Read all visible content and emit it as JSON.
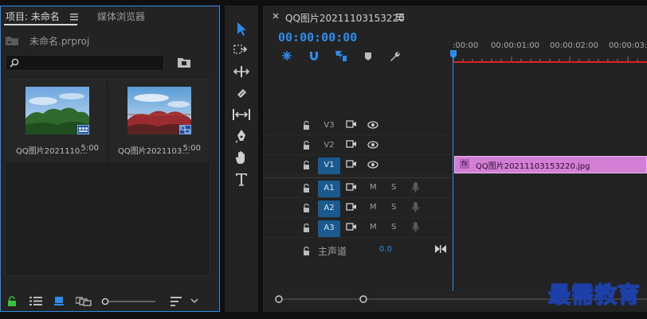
{
  "colors": {
    "accent": "#2d8ceb",
    "clip": "#d47fd6",
    "track_active": "#1b5a8f",
    "playhead_red": "#e02020"
  },
  "project": {
    "tab_project": "项目: 未命名",
    "tab_media": "媒体浏览器",
    "file_name": "未命名.prproj",
    "search_value": "",
    "clips": [
      {
        "name": "QQ图片2021110...",
        "duration": "5:00",
        "type": "image"
      },
      {
        "name": "QQ图片2021103...",
        "duration": "5:00",
        "type": "sequence"
      }
    ]
  },
  "tools": [
    "selection-tool",
    "track-select-forward-tool",
    "ripple-edit-tool",
    "razor-tool",
    "slip-tool",
    "pen-tool",
    "hand-tool",
    "type-tool"
  ],
  "timeline": {
    "sequence_title": "QQ图片20211103153220",
    "timecode": "00:00:00:00",
    "ruler_labels": [
      ":00:00",
      "00:00:01:00",
      "00:00:02:00",
      "00:00:03:0"
    ],
    "video_tracks": [
      {
        "label": "V3",
        "active": false
      },
      {
        "label": "V2",
        "active": false
      },
      {
        "label": "V1",
        "active": true
      }
    ],
    "audio_tracks": [
      {
        "label": "A1",
        "m": "M",
        "s": "S"
      },
      {
        "label": "A2",
        "m": "M",
        "s": "S"
      },
      {
        "label": "A3",
        "m": "M",
        "s": "S"
      }
    ],
    "master": {
      "label": "主声道",
      "value": "0.0"
    },
    "clip_v1": {
      "fx": "fx",
      "name": "QQ图片20211103153220.jpg"
    }
  },
  "watermark": "最需教育"
}
